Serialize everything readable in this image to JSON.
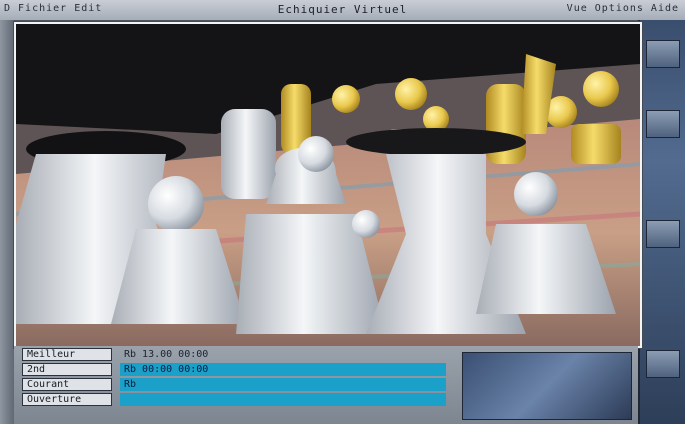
{
  "window": {
    "title": "Echiquier Virtuel",
    "left_menu": "D  Fichier  Edit",
    "right_menu": "Vue  Options  Aide"
  },
  "bottom_panel": {
    "rows": [
      {
        "label": "Meilleur",
        "value": "Rb  13.00 00:00"
      },
      {
        "label": "2nd",
        "value": "Rb  00:00 00:00"
      },
      {
        "label": "Courant",
        "value": "Rb"
      },
      {
        "label": "Ouverture",
        "value": ""
      }
    ]
  },
  "colors": {
    "white_pieces": "#e8ebee",
    "black_pieces": "#1b1b1b",
    "gold_pieces": "#e6c74a",
    "board": "#a77b6d",
    "value_field": "#1aa0c9"
  }
}
